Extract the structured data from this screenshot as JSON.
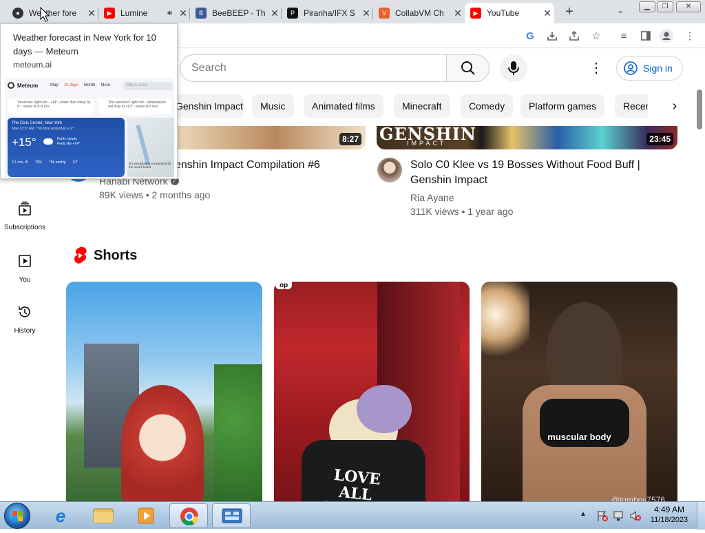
{
  "tabs": [
    {
      "title": "Weather forecast in New York for 10 days — Meteum",
      "short": "Weather fore",
      "color": "#333333"
    },
    {
      "title": "Lumine",
      "short": "Lumine",
      "color": "#ff0000"
    },
    {
      "title": "BeeBEEP - Th",
      "short": "BeeBEEP - Th",
      "color": "#3b5a9a"
    },
    {
      "title": "Piranha/IFX",
      "short": "Piranha/IFX S",
      "color": "#111111"
    },
    {
      "title": "CollabVM Ch",
      "short": "CollabVM Ch",
      "color": "#e8612c"
    },
    {
      "title": "YouTube",
      "short": "YouTube",
      "color": "#ff0000"
    }
  ],
  "hover_card": {
    "title": "Weather forecast in New York for 10 days — Meteum",
    "domain": "meteum.ai",
    "preview": {
      "brand": "Meteum",
      "nav": [
        "Map",
        "10 days",
        "Month",
        "More"
      ],
      "search_placeholder": "City or area",
      "notice1": "Tomorrow: light rain · +14°, colder than today by 6° · winds at 8–9 m/s",
      "notice2": "This weekend: light rain · temperature will drop to +13° · winds at 6 m/s",
      "location": "The Civic Center, New York",
      "time_line": "Now 12:37 AM. This time yesterday +12°",
      "temp": "+15°",
      "condition": "Partly cloudy",
      "feels": "Feels like +14°",
      "wind": "2.1 m/s, W",
      "humidity": "75%",
      "pressure": "756 mmHg",
      "uv": "12°",
      "precip": "No precipitation is expected for the next 2 hours"
    }
  },
  "search": {
    "placeholder": "Search"
  },
  "signin_label": "Sign in",
  "chips": [
    "Genshin Impact",
    "Music",
    "Animated films",
    "Minecraft",
    "Comedy",
    "Platform games",
    "Recen"
  ],
  "sidebar": [
    {
      "label": "Subscriptions",
      "icon": "subscriptions-icon"
    },
    {
      "label": "You",
      "icon": "you-icon"
    },
    {
      "label": "History",
      "icon": "history-icon"
    }
  ],
  "videos": [
    {
      "title": "enshin Impact Compilation #6",
      "channel": "Hanabi Network",
      "verified": true,
      "meta": "89K views • 2 months ago",
      "duration": "8:27"
    },
    {
      "title": "Solo C0 Klee vs 19 Bosses Without Food Buff | Genshin Impact",
      "channel": "Ria Ayane",
      "meta": "311K views • 1 year ago",
      "duration": "23:45",
      "thumb_text": "GENSHIN",
      "thumb_sub": "IMPACT"
    }
  ],
  "shorts": {
    "heading": "Shorts",
    "items": [
      {
        "overlay": ""
      },
      {
        "overlay": "",
        "badge": "op",
        "shirt": "LOVE ALL TRUST FEW"
      },
      {
        "overlay": "muscular body",
        "handle": "@tomboy7576"
      }
    ]
  },
  "clock": {
    "time": "4:49 AM",
    "date": "11/18/2023"
  }
}
